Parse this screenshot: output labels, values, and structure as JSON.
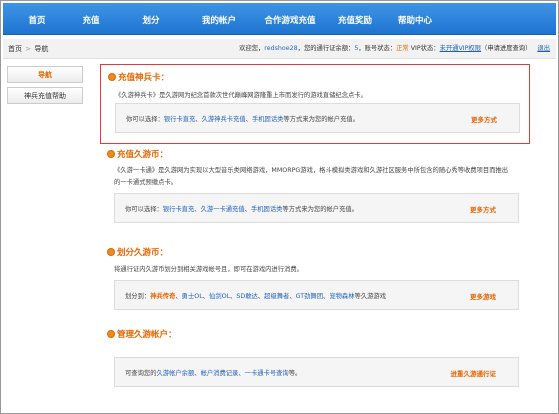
{
  "nav": {
    "items": [
      "首页",
      "充值",
      "划分",
      "我的帐户",
      "合作游戏充值",
      "充值奖励",
      "帮助中心"
    ]
  },
  "status": {
    "crumb_home": "首页",
    "crumb_sep": ">",
    "crumb_current": "导航",
    "welcome_prefix": "欢迎您，",
    "username": "redshoe28",
    "login_count_prefix": "，您的通行证余额：",
    "login_count": "5",
    "account_state_label": "，账号状态：",
    "account_state": "正常",
    "vip_label": " VIP状态：",
    "vip_state": "未开通VIP权限",
    "vip_query": "（申请进度查询）",
    "logout": "退出"
  },
  "sidebar": {
    "items": [
      "导航",
      "神兵充值帮助"
    ]
  },
  "sections": [
    {
      "title": "充值神兵卡：",
      "desc": "《久游神兵卡》是久游网为纪念首款次世代巅峰网游隆重上市而发行的游戏直储纪念点卡。",
      "box_prefix": "你可以选择：",
      "links": [
        "银行卡直充",
        "、",
        "久游神兵卡充值",
        "、",
        "手机固话类"
      ],
      "box_suffix": "等方式来为您的帐户充值。",
      "more": "更多方式"
    },
    {
      "title": "充值久游币：",
      "desc": "《久游一卡通》是久游网为实现以大型音乐类网络游戏，MMORPG游戏，格斗模拟类游戏和久游社区服务中所包含的随心秀等收费项目而推出的一卡通式预缴点卡。",
      "box_prefix": "你可以选择：",
      "links": [
        "银行卡直充",
        "、",
        "久游一卡通充值",
        "、",
        "手机固话类"
      ],
      "box_suffix": "等方式来为您的帐户充值。",
      "more": "更多方式"
    },
    {
      "title": "划分久游币：",
      "desc": "将通行证内久游币划分到相关游戏帐号且，即可在游戏内进行消费。",
      "box_prefix": "划分到：",
      "links": [
        "神兵传奇",
        "、",
        "勇士OL",
        "、",
        "仙剑OL",
        "、",
        "SD敢达",
        "、",
        "超级舞者",
        "、",
        "GT劲舞团",
        "、",
        "宠物森林"
      ],
      "box_suffix": "等久游游戏",
      "more": "更多游戏"
    },
    {
      "title": "管理久游帐户：",
      "desc": "",
      "box_prefix": "可查询您的",
      "links": [
        "久游帐户余额",
        "、",
        "帐户消费记录",
        "、",
        "一卡通卡号查询"
      ],
      "box_suffix": "等。",
      "more": "进重久游通行证"
    }
  ],
  "colors": {
    "nav_blue": "#2b84dd",
    "accent_orange": "#e66600",
    "link_blue": "#1f5fbf",
    "highlight_border": "#e53a3a"
  }
}
